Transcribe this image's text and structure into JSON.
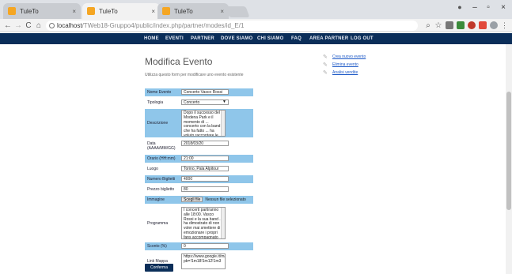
{
  "browser": {
    "tabs": [
      {
        "title": "TuleTo",
        "active": false
      },
      {
        "title": "TuleTo",
        "active": true
      },
      {
        "title": "TuleTo",
        "active": false
      }
    ],
    "tab_close": "×",
    "window_controls": {
      "minimize": "–",
      "maximize": "▫",
      "close": "×"
    },
    "nav": {
      "back": "←",
      "forward": "→",
      "reload": "C",
      "home": "⌂"
    },
    "url_host": "localhost",
    "url_path": "/TWeb18-Gruppo4/public/index.php/partner/modes/id_E/1",
    "accent_tab": "#f5a623"
  },
  "site_nav": {
    "items": [
      "HOME",
      "EVENTI",
      "PARTNER",
      "DOVE SIAMO",
      "CHI SIAMO",
      "FAQ",
      "AREA PARTNER",
      "LOG OUT"
    ],
    "bg_color": "#0b2e59"
  },
  "page": {
    "title": "Modifica Evento",
    "subtitle": "Utilizza questo form per modificare uno evento esistente"
  },
  "side_links": [
    "Crea nuovo evento",
    "Elimina evento",
    "Analisi vendite"
  ],
  "form": {
    "name": {
      "label": "Nome Evento",
      "value": "Concerto Vasco Rossi"
    },
    "type": {
      "label": "Tipologia",
      "value": "Concerto"
    },
    "description": {
      "label": "Descrizione",
      "value": "Dopo il successo del Modena Park e il momento di ... concerto con la band che ha fatto ... ha voluto raccontare le emozioni vissute di Vasco Rossi che il"
    },
    "date": {
      "label": "Data (AAAA/MM/GG)",
      "value": "2018/03/20"
    },
    "time": {
      "label": "Orario (HH:mm)",
      "value": "21:00"
    },
    "place": {
      "label": "Luogo",
      "value": "Torino, Pala Alpitour"
    },
    "tickets": {
      "label": "Numero Biglietti",
      "value": "4000"
    },
    "price": {
      "label": "Prezzo biglietto",
      "value": "80"
    },
    "image": {
      "label": "Immagine",
      "button": "Scegli file",
      "status": "Nessun file selezionato"
    },
    "program": {
      "label": "Programma",
      "value": "I concerti partiranno alle 18:00. Vasco Rossi e la sua band ... ha dimostrato di non voler mai smettere di emozionare i propri fans accompagnato da gli storici sostegni"
    },
    "discount": {
      "label": "Sconto (%)",
      "value": "0"
    },
    "map": {
      "label": "Link Mappa",
      "value": "https://www.google.it/maps/embed?pb=!1m18!1m12!1m3"
    }
  },
  "submit_label": "Conferma",
  "highlight_color": "#8fc6ea"
}
